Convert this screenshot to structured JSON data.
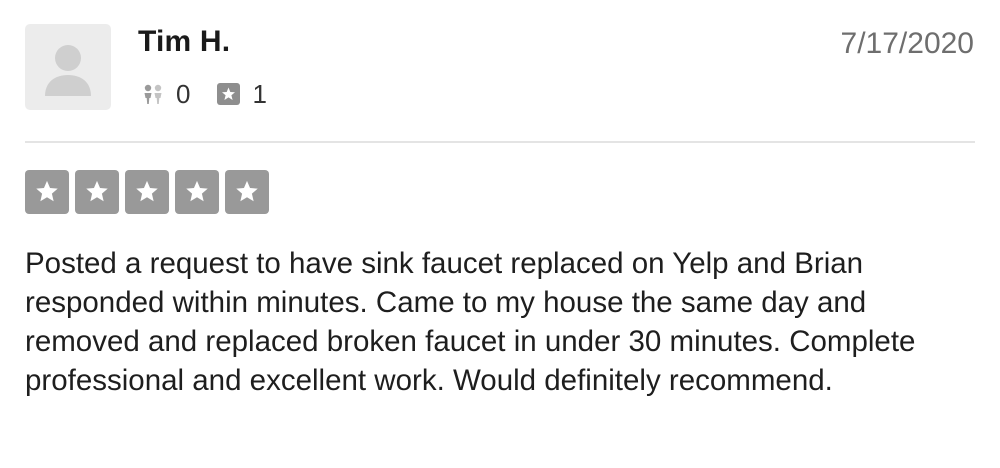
{
  "review": {
    "user_name": "Tim H.",
    "date": "7/17/2020",
    "friends_icon": "friends-icon",
    "friends_count": "0",
    "reviews_icon": "star-badge-icon",
    "reviews_count": "1",
    "rating": 5,
    "rating_max": 5,
    "text": "Posted a request to have sink faucet replaced on Yelp and Brian responded within minutes. Came to my house the same day and removed and replaced broken faucet in under 30 minutes. Complete professional and excellent work. Would definitely recommend."
  },
  "colors": {
    "star_box": "#999999",
    "avatar_bg": "#ececec",
    "divider": "#e4e4e4"
  }
}
